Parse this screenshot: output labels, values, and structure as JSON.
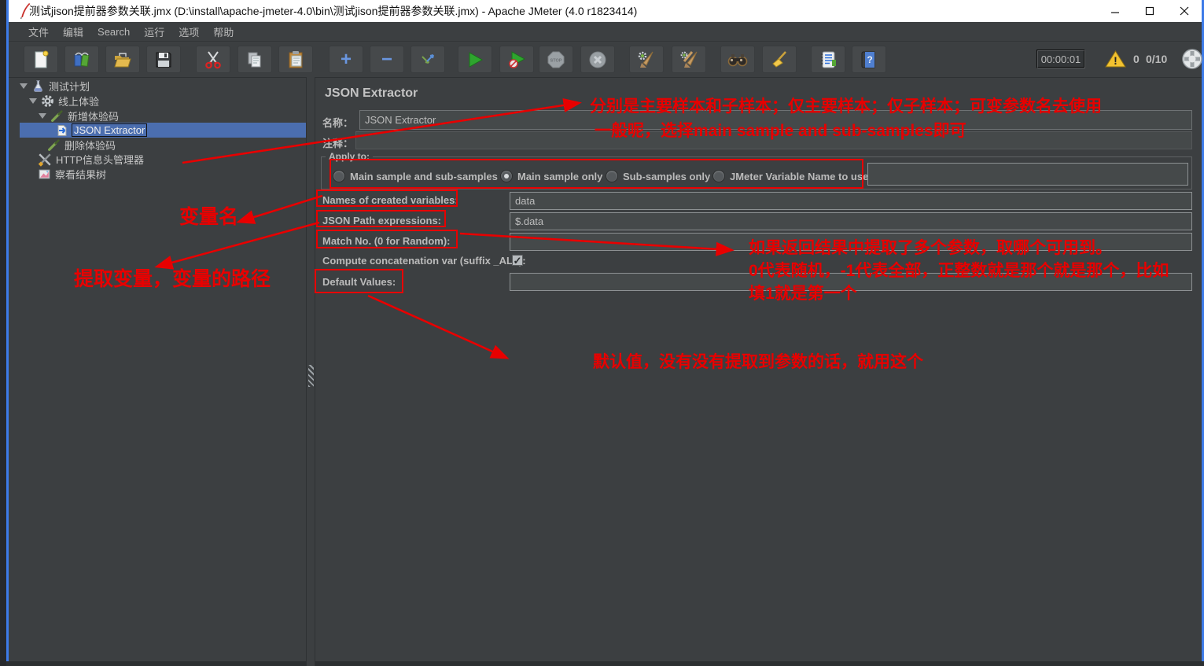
{
  "window": {
    "title": "测试jison提前器参数关联.jmx (D:\\install\\apache-jmeter-4.0\\bin\\测试jison提前器参数关联.jmx) - Apache JMeter (4.0 r1823414)",
    "control_icons": [
      "minimize",
      "maximize",
      "close"
    ],
    "logo_icon": "jmeter-feather"
  },
  "menu_bar": {
    "items": [
      "文件",
      "编辑",
      "Search",
      "运行",
      "选项",
      "帮助"
    ]
  },
  "toolbar": {
    "button_icons": [
      "new-file",
      "templates",
      "open-file",
      "save",
      "cut",
      "copy",
      "paste",
      "add",
      "remove",
      "toggle",
      "start",
      "start-no-pauses",
      "stop",
      "shutdown",
      "clear",
      "clear-all",
      "search",
      "search-reset",
      "function-helper",
      "help"
    ],
    "add_glyph": "+",
    "remove_glyph": "−",
    "stop_label": "STOP",
    "help_glyph": "?",
    "warning_glyph": "!",
    "timer": "00:00:01",
    "error_count": "0",
    "thread_count": "0/10"
  },
  "tree": {
    "items": [
      {
        "label": "测试计划",
        "icon": "test-plan",
        "selected": false
      },
      {
        "label": "线上体验",
        "icon": "thread-group",
        "selected": false
      },
      {
        "label": "新增体验码",
        "icon": "http-sampler",
        "selected": false
      },
      {
        "label": "JSON Extractor",
        "icon": "json-extractor",
        "selected": true
      },
      {
        "label": "删除体验码",
        "icon": "http-sampler",
        "selected": false
      },
      {
        "label": "HTTP信息头管理器",
        "icon": "header-manager",
        "selected": false
      },
      {
        "label": "察看结果树",
        "icon": "view-results-tree",
        "selected": false
      }
    ]
  },
  "main": {
    "title": "JSON Extractor",
    "name": {
      "label": "名称：",
      "value": "JSON Extractor"
    },
    "comment": {
      "label": "注释：",
      "value": ""
    },
    "apply_to": {
      "group_label": "Apply to:",
      "options": [
        {
          "label": "Main sample and sub-samples",
          "selected": false
        },
        {
          "label": "Main sample only",
          "selected": true
        },
        {
          "label": "Sub-samples only",
          "selected": false
        },
        {
          "label": "JMeter Variable Name to use",
          "selected": false
        }
      ],
      "variable_name_value": ""
    },
    "fields": [
      {
        "label": "Names of created variables:",
        "value": "data"
      },
      {
        "label": "JSON Path expressions:",
        "value": "$.data"
      },
      {
        "label": "Match No. (0 for Random):",
        "value": ""
      },
      {
        "label": "Default Values:",
        "value": ""
      }
    ],
    "concat_checkbox": {
      "label": "Compute concatenation var (suffix _ALL):",
      "checked": true,
      "glyph": "✓"
    }
  },
  "annotations": {
    "color": "#e80000",
    "apply_note_line1": "分别是主要样本和子样本；仅主要样本；仅子样本；可变参数名去使用",
    "apply_note_line2": "一般呢，选择main sample and sub-samples即可",
    "var_name_note": "变量名",
    "path_note": "提取变量，变量的路径",
    "match_note_line1": "如果返回结果中提取了多个参数，取哪个可用到。",
    "match_note_line2": "0代表随机，-1代表全部，正整数就是那个就是那个，比如",
    "match_note_line3": "填1就是第一个",
    "default_note": "默认值，没有没有提取到参数的话，就用这个"
  }
}
